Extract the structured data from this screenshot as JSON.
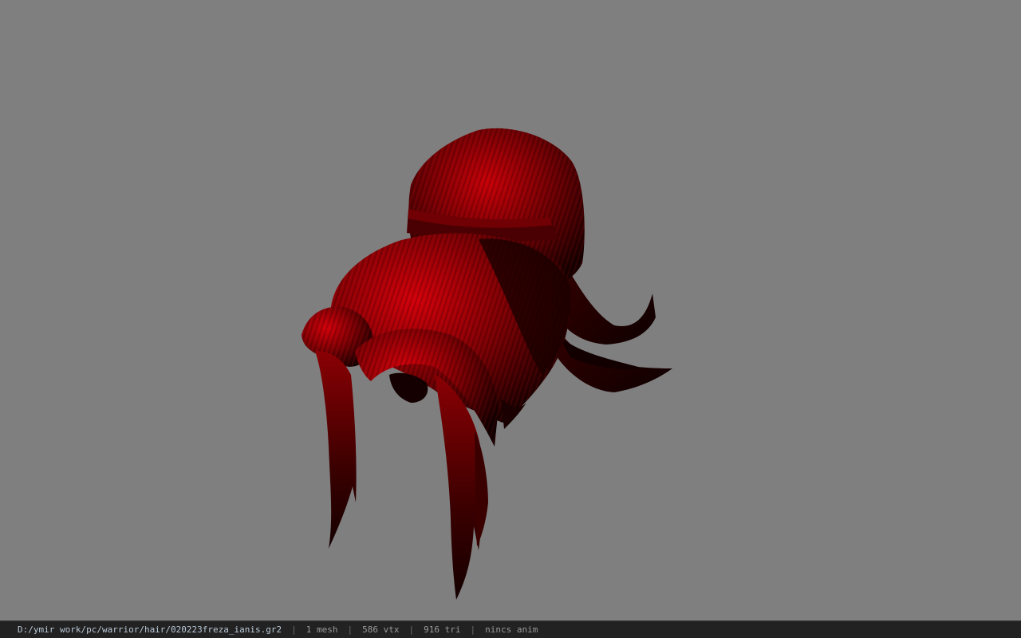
{
  "viewport": {
    "background_color": "#7f7f7f",
    "model": {
      "subject": "hair-mesh",
      "color": "#8b0000"
    }
  },
  "status_bar": {
    "file_path": "D:/ymir work/pc/warrior/hair/020223freza_ianis.gr2",
    "mesh_count": "1 mesh",
    "vertex_count": "586 vtx",
    "triangle_count": "916 tri",
    "anim": "nincs anim",
    "separator": "|"
  }
}
